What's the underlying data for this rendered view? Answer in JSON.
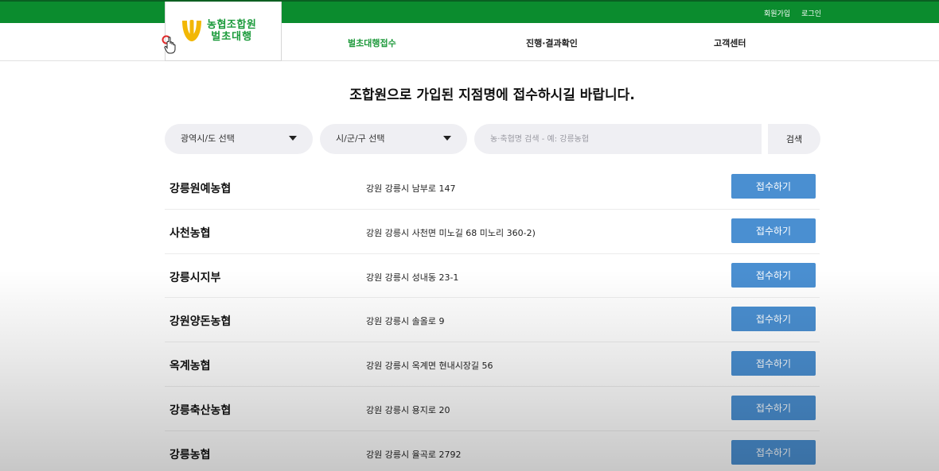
{
  "top_links": {
    "signup": "회원가입",
    "login": "로그인"
  },
  "logo": {
    "line1": "농협조합원",
    "line2": "벌초대행"
  },
  "nav": {
    "items": [
      {
        "label": "벌초대행접수",
        "active": true
      },
      {
        "label": "진행·결과확인",
        "active": false
      },
      {
        "label": "고객센터",
        "active": false
      }
    ]
  },
  "title": "조합원으로 가입된 지점명에 접수하시길 바랍니다.",
  "filters": {
    "region": "광역시/도 선택",
    "district": "시/군/구 선택",
    "search_placeholder": "농·축협명 검색 - 예: 강릉농협",
    "search_button": "검색"
  },
  "branches": [
    {
      "name": "강릉원예농협",
      "address": "강원 강릉시 남부로 147",
      "button": "접수하기"
    },
    {
      "name": "사천농협",
      "address": "강원 강릉시 사천면 미노길 68 미노리 360-2)",
      "button": "접수하기"
    },
    {
      "name": "강릉시지부",
      "address": "강원 강릉시 성내동 23-1",
      "button": "접수하기"
    },
    {
      "name": "강원양돈농협",
      "address": "강원 강릉시 솔올로 9",
      "button": "접수하기"
    },
    {
      "name": "옥계농협",
      "address": "강원 강릉시 옥계면 현내시장길 56",
      "button": "접수하기"
    },
    {
      "name": "강릉축산농협",
      "address": "강원 강릉시 용지로 20",
      "button": "접수하기"
    },
    {
      "name": "강릉농협",
      "address": "강원 강릉시 율곡로 2792",
      "button": "접수하기"
    }
  ],
  "colors": {
    "brand_green": "#0b8c2e",
    "nav_active": "#1f9a3c",
    "button_blue": "#4a8fd1",
    "field_bg": "#efeff3"
  },
  "icons": {
    "logo": "nh-logo-icon",
    "cursor": "hand-cursor-icon",
    "caret": "caret-down-icon"
  }
}
